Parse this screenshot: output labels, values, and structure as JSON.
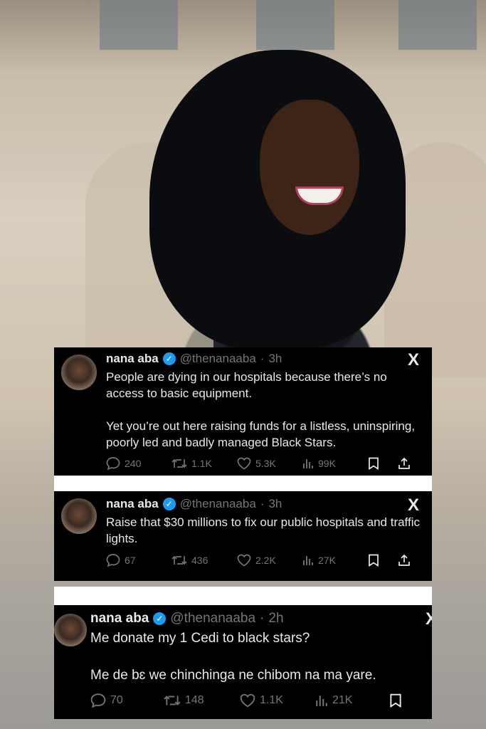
{
  "tweets": [
    {
      "name": "nana aba",
      "handle": "@thenanaaba",
      "separator": "·",
      "time": "3h",
      "x_logo": "X",
      "paragraphs": [
        "People are dying in our hospitals because there’s no access to basic equipment.",
        "Yet you’re out here raising funds for a listless, uninspiring, poorly led and badly managed Black Stars."
      ],
      "replies": "240",
      "retweets": "1.1K",
      "likes": "5.3K",
      "views": "99K"
    },
    {
      "name": "nana aba",
      "handle": "@thenanaaba",
      "separator": "·",
      "time": "3h",
      "x_logo": "X",
      "paragraphs": [
        "Raise that  $30 millions to fix our public hospitals and traffic lights."
      ],
      "replies": "67",
      "retweets": "436",
      "likes": "2.2K",
      "views": "27K"
    },
    {
      "name": "nana aba",
      "handle": "@thenanaaba",
      "separator": "·",
      "time": "2h",
      "x_logo": "X",
      "paragraphs": [
        "Me donate my 1 Cedi to black stars?",
        "Me de bɛ we chinchinga ne chibom na ma yare."
      ],
      "replies": "70",
      "retweets": "148",
      "likes": "1.1K",
      "views": "21K"
    }
  ],
  "icons": {
    "verified": "verified-badge-icon",
    "reply": "reply-icon",
    "retweet": "retweet-icon",
    "like": "heart-icon",
    "views": "views-icon",
    "bookmark": "bookmark-icon",
    "share": "share-icon"
  },
  "colors": {
    "card_bg": "#000000",
    "text": "#e7e9ea",
    "muted": "#71767b",
    "verified": "#1d9bf0"
  }
}
